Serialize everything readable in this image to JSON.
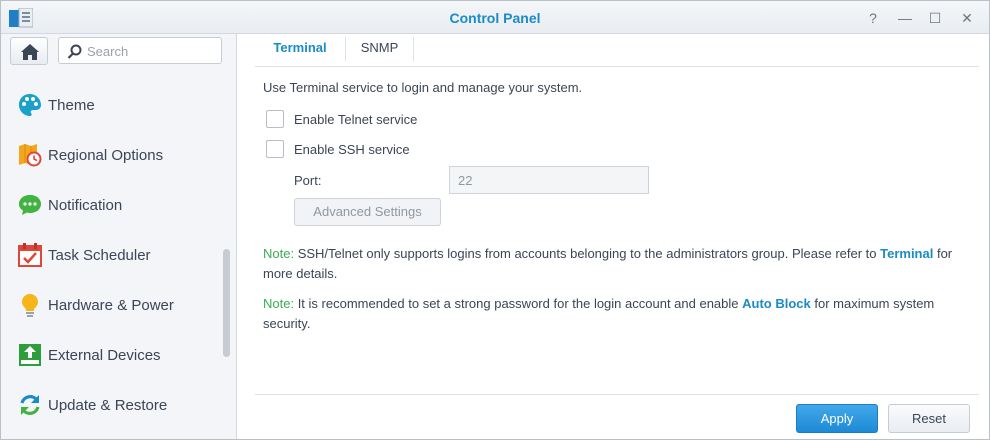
{
  "window": {
    "title": "Control Panel"
  },
  "titlebar_buttons": {
    "help": "?",
    "minimize": "—",
    "maximize": "☐",
    "close": "✕"
  },
  "search": {
    "placeholder": "Search"
  },
  "sidebar": {
    "items": [
      {
        "label": "Theme",
        "icon": "palette-icon"
      },
      {
        "label": "Regional Options",
        "icon": "regional-options-icon"
      },
      {
        "label": "Notification",
        "icon": "notification-icon"
      },
      {
        "label": "Task Scheduler",
        "icon": "calendar-check-icon"
      },
      {
        "label": "Hardware & Power",
        "icon": "lightbulb-icon"
      },
      {
        "label": "External Devices",
        "icon": "external-devices-icon"
      },
      {
        "label": "Update & Restore",
        "icon": "update-restore-icon"
      }
    ]
  },
  "tabs": [
    {
      "label": "Terminal",
      "active": true
    },
    {
      "label": "SNMP",
      "active": false
    }
  ],
  "terminal": {
    "description": "Use Terminal service to login and manage your system.",
    "telnet_label": "Enable Telnet service",
    "telnet_enabled": false,
    "ssh_label": "Enable SSH service",
    "ssh_enabled": false,
    "port_label": "Port:",
    "port_value": "22",
    "advanced_button": "Advanced Settings",
    "note1": {
      "key": "Note:",
      "text_before": " SSH/Telnet only supports logins from accounts belonging to the administrators group. Please refer to ",
      "link": "Terminal",
      "text_after": " for more details."
    },
    "note2": {
      "key": "Note:",
      "text_before": " It is recommended to set a strong password for the login account and enable ",
      "link": "Auto Block",
      "text_after": " for maximum system security."
    }
  },
  "footer": {
    "apply": "Apply",
    "reset": "Reset"
  },
  "colors": {
    "accent": "#1a8bc7",
    "note": "#3bac52",
    "apply_button": "#2b95dd"
  }
}
